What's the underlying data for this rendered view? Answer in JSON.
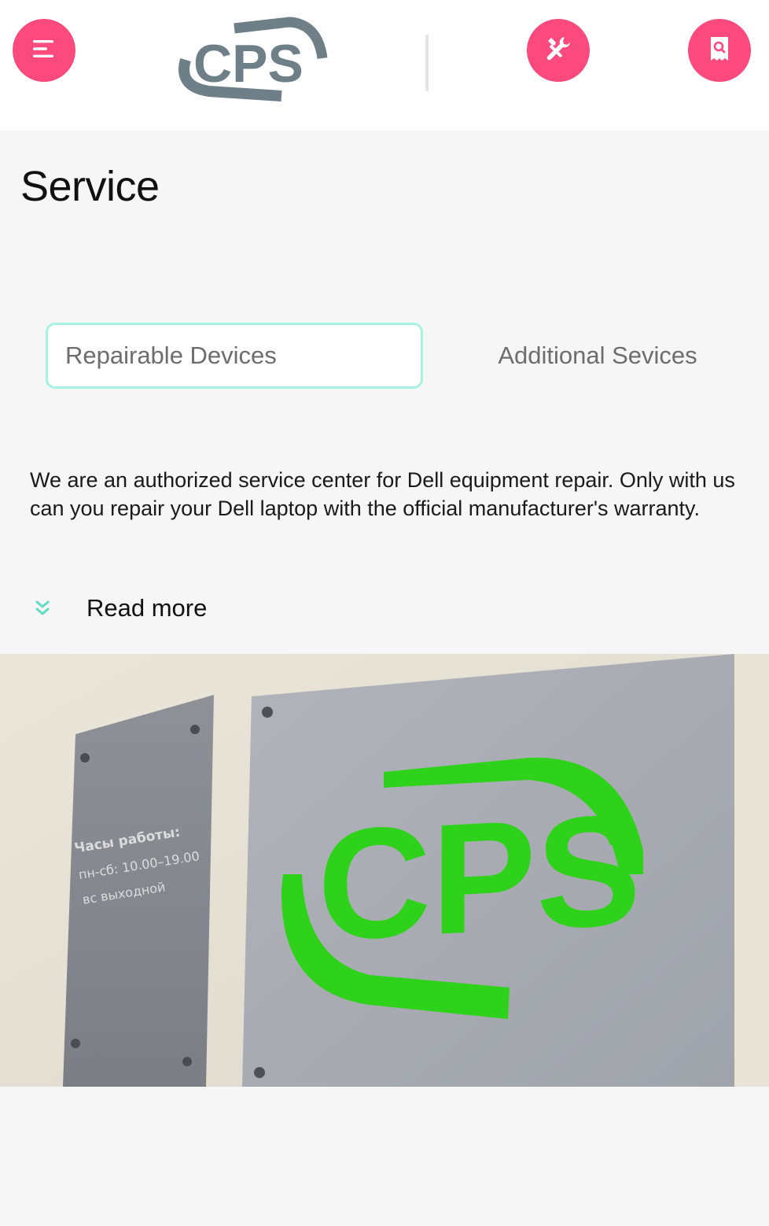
{
  "header": {
    "menu_icon": "hamburger-menu-icon",
    "tools_icon": "wrench-screwdriver-icon",
    "search_icon": "receipt-search-icon",
    "logo_text": "CPS",
    "accent_color": "#fc4a7f",
    "logo_color": "#6e7f88"
  },
  "page": {
    "title": "Service"
  },
  "tabs": [
    {
      "label": "Repairable Devices",
      "active": true
    },
    {
      "label": "Additional Sevices",
      "active": false
    }
  ],
  "intro": {
    "text": "We are an authorized service center for Dell equipment repair. Only with us can you repair your Dell laptop with the official manufacturer's warranty."
  },
  "read_more": {
    "label": "Read more",
    "icon": "double-chevron-down-icon",
    "icon_color": "#5fdcc4"
  },
  "photo": {
    "sign_logo_text": "CPS",
    "sign_logo_color": "#2fd21a",
    "plaque_heading": "Часы работы:",
    "plaque_line_1": "пн-сб: 10.00–19.00",
    "plaque_line_2": "вс выходной"
  },
  "colors": {
    "tab_active_border": "#a7f2e0",
    "page_background": "#f6f6f6"
  }
}
